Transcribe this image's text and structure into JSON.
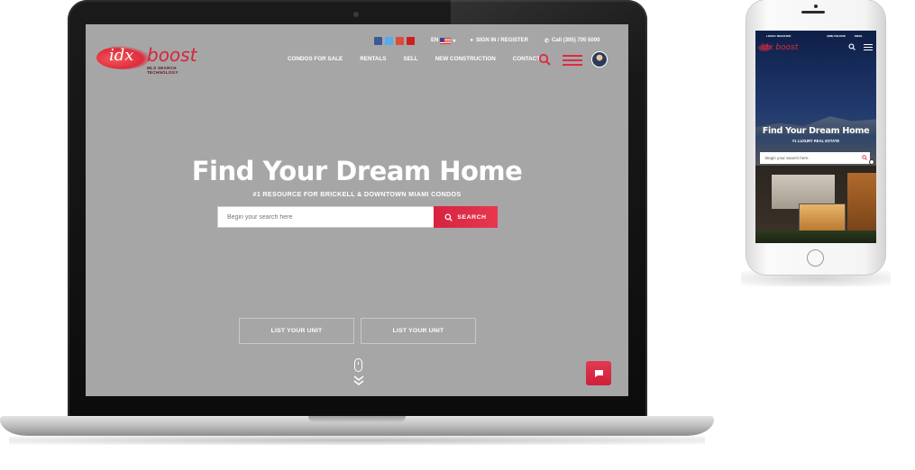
{
  "desktop": {
    "logo": {
      "idx": "idx",
      "boost": "boost",
      "tagline": "MLS SEARCH TECHNOLOGY"
    },
    "topbar": {
      "social_icons": [
        "facebook-icon",
        "twitter-icon",
        "google-plus-icon",
        "youtube-icon"
      ],
      "language": "EN",
      "sign_in": "SIGN IN / REGISTER",
      "phone": "Call (305) 705 5000"
    },
    "nav": {
      "items": [
        "CONDOS FOR SALE",
        "RENTALS",
        "SELL",
        "NEW CONSTRUCTION",
        "CONTACT"
      ]
    },
    "hero": {
      "title": "Find Your Dream Home",
      "subtitle": "#1 RESOURCE FOR BRICKELL & DOWNTOWN MIAMI CONDOS",
      "search_placeholder": "Begin your search here",
      "search_button": "SEARCH"
    },
    "cta": {
      "list_unit_1": "LIST YOUR UNIT",
      "list_unit_2": "LIST YOUR UNIT"
    }
  },
  "mobile": {
    "topbar": {
      "login": "LOGIN / REGISTER",
      "phone": "(888) 533.8738",
      "email": "EMAIL"
    },
    "logo": "idx boost",
    "hero": {
      "title": "Find Your Dream Home",
      "subtitle": "#1 LUXURY REAL ESTATE",
      "search_placeholder": "Begin your search here"
    }
  },
  "colors": {
    "accent": "#e0293f",
    "screen_overlay": "#a6a6a6",
    "text": "#ffffff"
  }
}
